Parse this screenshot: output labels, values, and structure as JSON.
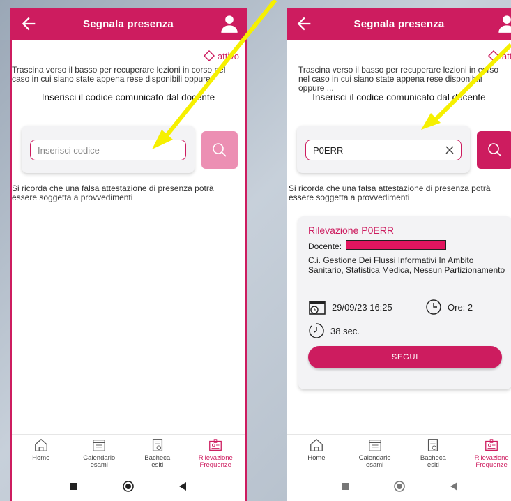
{
  "colors": {
    "brand": "#cd1c5f",
    "brand_disabled": "#ec8fb3",
    "arrow": "#f6f000"
  },
  "screens": {
    "left": {
      "title": "Segnala presenza",
      "status_label": "attivo",
      "hint": "Trascina verso il basso per recuperare lezioni in corso nel caso in cui siano state appena rese disponibili oppure",
      "heading": "Inserisci il codice comunicato dal docente",
      "input_placeholder": "Inserisci codice",
      "warning": "Si ricorda che una falsa attestazione di presenza potrà essere soggetta a provvedimenti"
    },
    "right": {
      "title": "Segnala presenza",
      "status_label": "attivo",
      "hint": "Trascina verso il basso per recuperare lezioni in corso nel caso in cui siano state appena rese disponibili oppure ...",
      "heading": "Inserisci il codice comunicato dal docente",
      "input_value": "P0ERR",
      "warning": "Si ricorda che una falsa attestazione di presenza potrà essere soggetta a provvedimenti",
      "result": {
        "title": "Rilevazione P0ERR",
        "docente_label": "Docente:",
        "course": "C.i. Gestione Dei Flussi Informativi In Ambito Sanitario, Statistica Medica, Nessun Partizionamento",
        "datetime": "29/09/23 16:25",
        "hours": "Ore: 2",
        "seconds": "38 sec.",
        "follow_label": "SEGUI"
      }
    }
  },
  "nav": [
    {
      "label1": "Home",
      "label2": "",
      "icon": "home-icon"
    },
    {
      "label1": "Calendario",
      "label2": "esami",
      "icon": "calendar-icon"
    },
    {
      "label1": "Bacheca",
      "label2": "esiti",
      "icon": "board-icon"
    },
    {
      "label1": "Rilevazione",
      "label2": "Frequenze",
      "icon": "attendance-icon"
    }
  ]
}
